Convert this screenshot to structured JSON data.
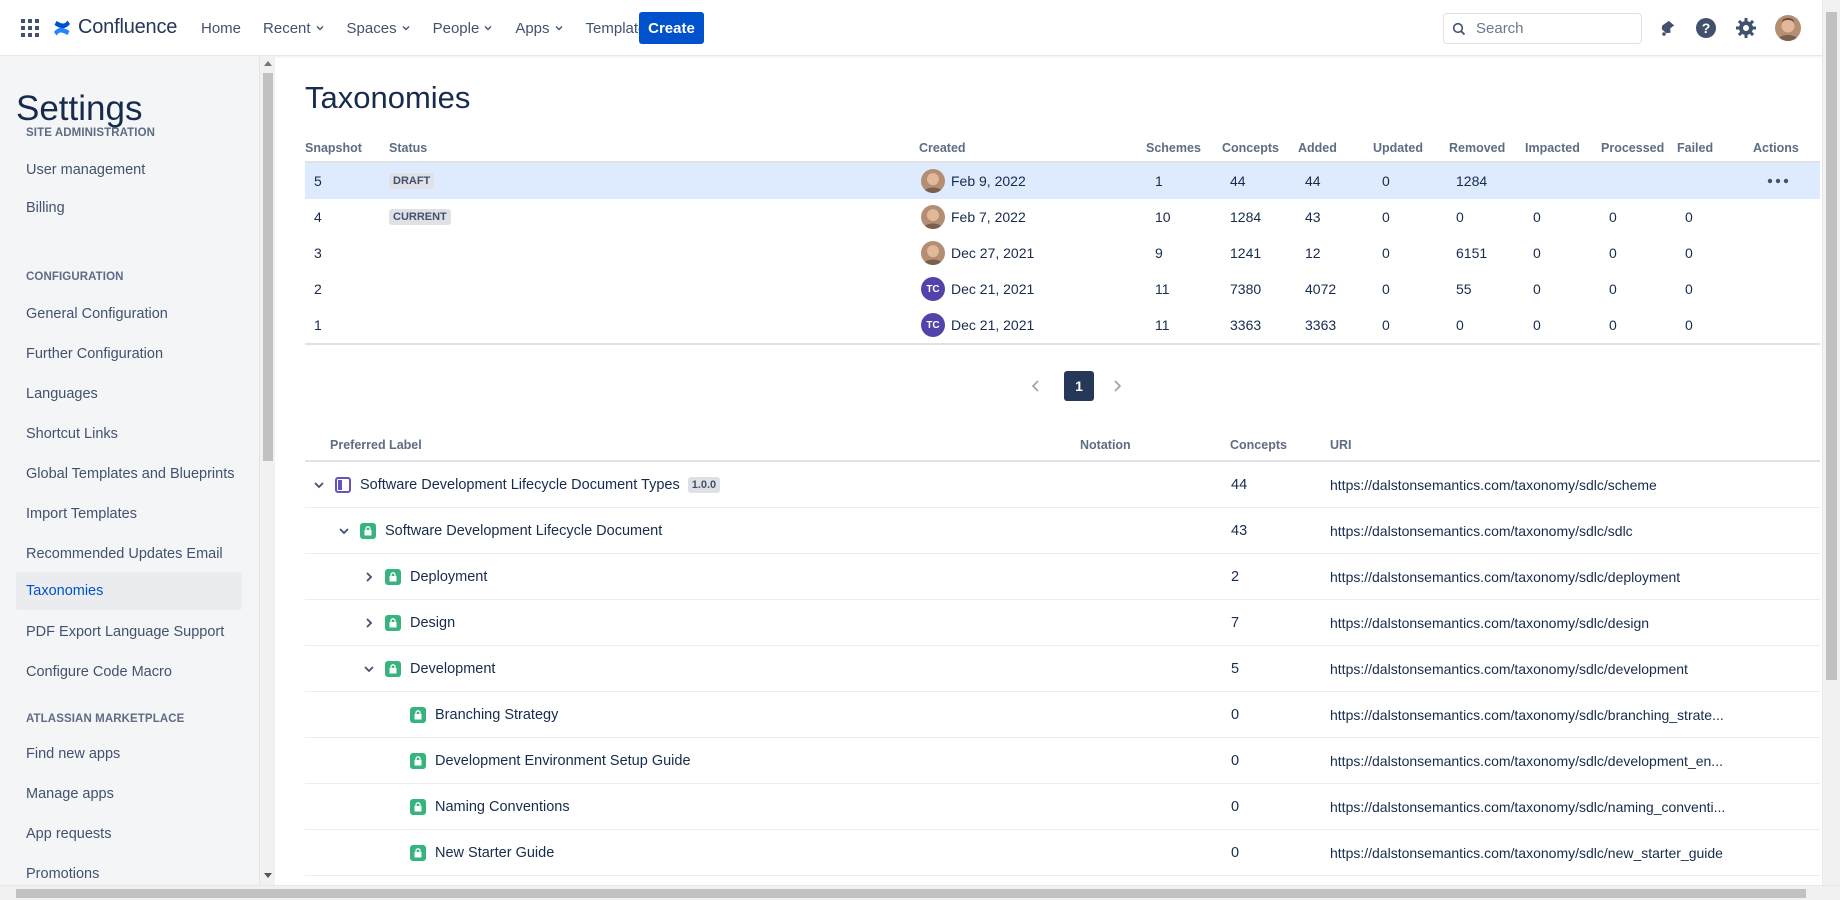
{
  "app": {
    "name": "Confluence",
    "nav": [
      "Home",
      "Recent",
      "Spaces",
      "People",
      "Apps",
      "Templates"
    ],
    "create_label": "Create",
    "search_placeholder": "Search",
    "accent_color": "#0052CC"
  },
  "sidebar": {
    "title": "Settings",
    "sections": [
      {
        "heading": "SITE ADMINISTRATION",
        "items": [
          "User management",
          "Billing"
        ]
      },
      {
        "heading": "CONFIGURATION",
        "items": [
          "General Configuration",
          "Further Configuration",
          "Languages",
          "Shortcut Links",
          "Global Templates and Blueprints",
          "Import Templates",
          "Recommended Updates Email",
          "Taxonomies",
          "PDF Export Language Support",
          "Configure Code Macro"
        ]
      },
      {
        "heading": "ATLASSIAN MARKETPLACE",
        "items": [
          "Find new apps",
          "Manage apps",
          "App requests",
          "Promotions"
        ]
      }
    ],
    "active_item": "Taxonomies"
  },
  "page": {
    "title": "Taxonomies"
  },
  "snapshots": {
    "columns": [
      "Snapshot",
      "Status",
      "Created",
      "Schemes",
      "Concepts",
      "Added",
      "Updated",
      "Removed",
      "Impacted",
      "Processed",
      "Failed",
      "Actions"
    ],
    "rows": [
      {
        "snapshot": "5",
        "status": "DRAFT",
        "creator": "photo",
        "created": "Feb 9, 2022",
        "schemes": "1",
        "concepts": "44",
        "added": "44",
        "updated": "0",
        "removed": "1284",
        "impacted": "",
        "processed": "",
        "failed": "",
        "selected": true
      },
      {
        "snapshot": "4",
        "status": "CURRENT",
        "creator": "photo",
        "created": "Feb 7, 2022",
        "schemes": "10",
        "concepts": "1284",
        "added": "43",
        "updated": "0",
        "removed": "0",
        "impacted": "0",
        "processed": "0",
        "failed": "0"
      },
      {
        "snapshot": "3",
        "status": "",
        "creator": "photo",
        "created": "Dec 27, 2021",
        "schemes": "9",
        "concepts": "1241",
        "added": "12",
        "updated": "0",
        "removed": "6151",
        "impacted": "0",
        "processed": "0",
        "failed": "0"
      },
      {
        "snapshot": "2",
        "status": "",
        "creator": "TC",
        "created": "Dec 21, 2021",
        "schemes": "11",
        "concepts": "7380",
        "added": "4072",
        "updated": "0",
        "removed": "55",
        "impacted": "0",
        "processed": "0",
        "failed": "0"
      },
      {
        "snapshot": "1",
        "status": "",
        "creator": "TC",
        "created": "Dec 21, 2021",
        "schemes": "11",
        "concepts": "3363",
        "added": "3363",
        "updated": "0",
        "removed": "0",
        "impacted": "0",
        "processed": "0",
        "failed": "0"
      }
    ],
    "pagination": {
      "current_page": "1"
    }
  },
  "concepts": {
    "columns": [
      "Preferred Label",
      "Notation",
      "Concepts",
      "URI"
    ],
    "rows": [
      {
        "label": "Software Development Lifecycle Document Types",
        "version": "1.0.0",
        "type": "scheme",
        "level": 0,
        "toggle": "expanded",
        "notation": "",
        "concepts": "44",
        "uri": "https://dalstonsemantics.com/taxonomy/sdlc/scheme"
      },
      {
        "label": "Software Development Lifecycle Document",
        "type": "concept",
        "level": 1,
        "toggle": "expanded",
        "notation": "",
        "concepts": "43",
        "uri": "https://dalstonsemantics.com/taxonomy/sdlc/sdlc"
      },
      {
        "label": "Deployment",
        "type": "concept",
        "level": 2,
        "toggle": "collapsed",
        "notation": "",
        "concepts": "2",
        "uri": "https://dalstonsemantics.com/taxonomy/sdlc/deployment"
      },
      {
        "label": "Design",
        "type": "concept",
        "level": 2,
        "toggle": "collapsed",
        "notation": "",
        "concepts": "7",
        "uri": "https://dalstonsemantics.com/taxonomy/sdlc/design"
      },
      {
        "label": "Development",
        "type": "concept",
        "level": 2,
        "toggle": "expanded",
        "notation": "",
        "concepts": "5",
        "uri": "https://dalstonsemantics.com/taxonomy/sdlc/development"
      },
      {
        "label": "Branching Strategy",
        "type": "concept",
        "level": 3,
        "toggle": "none",
        "notation": "",
        "concepts": "0",
        "uri": "https://dalstonsemantics.com/taxonomy/sdlc/branching_strate..."
      },
      {
        "label": "Development Environment Setup Guide",
        "type": "concept",
        "level": 3,
        "toggle": "none",
        "notation": "",
        "concepts": "0",
        "uri": "https://dalstonsemantics.com/taxonomy/sdlc/development_en..."
      },
      {
        "label": "Naming Conventions",
        "type": "concept",
        "level": 3,
        "toggle": "none",
        "notation": "",
        "concepts": "0",
        "uri": "https://dalstonsemantics.com/taxonomy/sdlc/naming_conventi..."
      },
      {
        "label": "New Starter Guide",
        "type": "concept",
        "level": 3,
        "toggle": "none",
        "notation": "",
        "concepts": "0",
        "uri": "https://dalstonsemantics.com/taxonomy/sdlc/new_starter_guide"
      }
    ]
  }
}
